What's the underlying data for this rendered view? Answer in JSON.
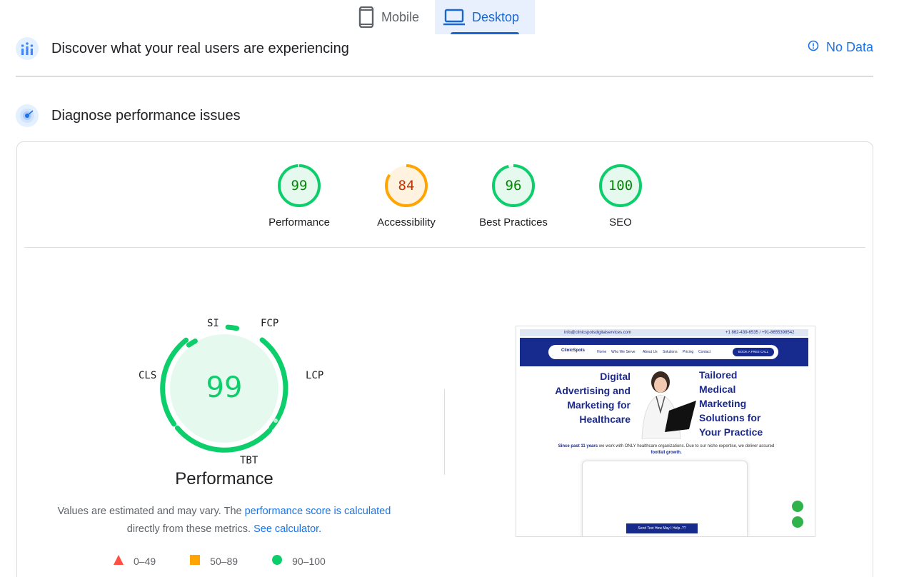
{
  "tabs": [
    {
      "label": "Mobile",
      "icon": "phone-icon",
      "active": false
    },
    {
      "label": "Desktop",
      "icon": "laptop-icon",
      "active": true
    }
  ],
  "crux": {
    "title": "Discover what your real users are experiencing",
    "status": "No Data",
    "icon": "field-data-icon"
  },
  "diagnose": {
    "title": "Diagnose performance issues",
    "icon": "lab-data-icon"
  },
  "categories": [
    {
      "label": "Performance",
      "score": "99",
      "color": "#0cce6b",
      "text_color": "#008800"
    },
    {
      "label": "Accessibility",
      "score": "84",
      "color": "#ffa400",
      "text_color": "#c33300"
    },
    {
      "label": "Best Practices",
      "score": "96",
      "color": "#0cce6b",
      "text_color": "#008800"
    },
    {
      "label": "SEO",
      "score": "100",
      "color": "#0cce6b",
      "text_color": "#008800"
    }
  ],
  "performance": {
    "score": "99",
    "title": "Performance",
    "metrics": [
      "SI",
      "FCP",
      "LCP",
      "TBT",
      "CLS"
    ]
  },
  "note": {
    "part1": "Values are estimated and may vary. The ",
    "link1": "performance score is calculated",
    "part2": "directly from these metrics.",
    "link2": "See calculator."
  },
  "legend": [
    {
      "range": "0–49",
      "shape": "triangle",
      "color": "#ff4e42"
    },
    {
      "range": "50–89",
      "shape": "square",
      "color": "#ffa400"
    },
    {
      "range": "90–100",
      "shape": "circle",
      "color": "#0cce6b"
    }
  ],
  "screenshot": {
    "email": "info@clinicspotsdigitalservices.com",
    "phone": "+1 862-439-6535 / +91-8655398542",
    "brand": "ClinicSpots",
    "nav": [
      "Home",
      "Who We Serve",
      "About Us",
      "Solutions",
      "Pricing",
      "Contact"
    ],
    "cta": "BOOK A FREE CALL",
    "hero_left": [
      "Digital",
      "Advertising and",
      "Marketing for",
      "Healthcare"
    ],
    "hero_right": [
      "Tailored",
      "Medical",
      "Marketing",
      "Solutions for",
      "Your Practice"
    ],
    "sub_bold": "Since past 11 years",
    "sub_text": " we work with ONLY healthcare organizations. Due to our niche expertise, we deliver assured",
    "sub_bold2": "footfall growth.",
    "chat": "Send Text   How May I Help..??"
  }
}
